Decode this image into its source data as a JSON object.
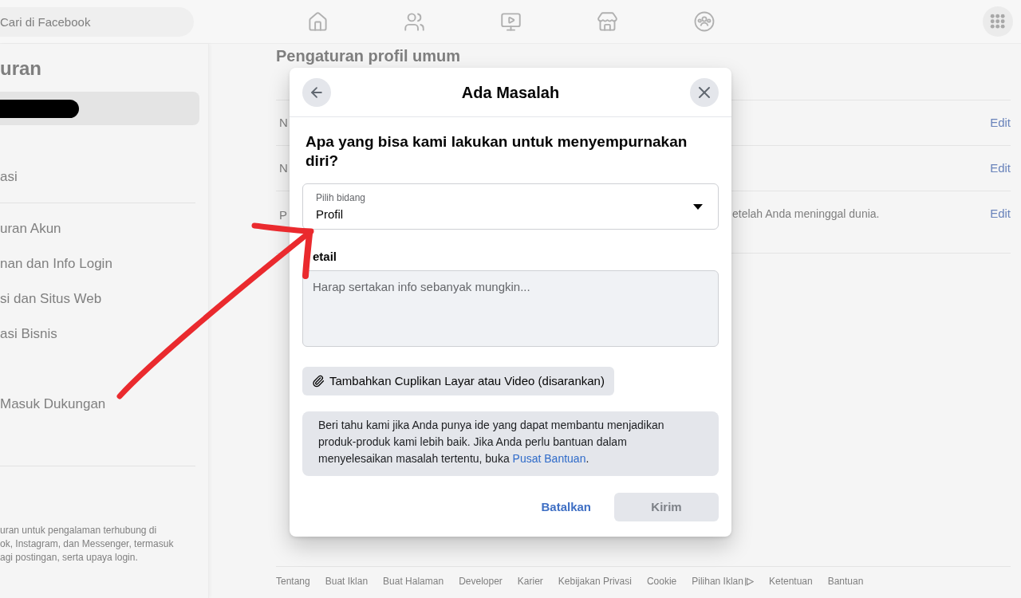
{
  "top_bar": {
    "search": {
      "placeholder": "Cari di Facebook"
    }
  },
  "sidebar": {
    "title": "uran",
    "sections": [
      {
        "items": [
          {
            "kind": "redacted",
            "selected": true
          },
          {
            "kind": "link",
            "label": "asi",
            "selected": false
          }
        ]
      },
      {
        "divider": true,
        "items": [
          {
            "kind": "link",
            "label": "uran Akun",
            "selected": false
          },
          {
            "kind": "link",
            "label": "nan dan Info Login",
            "selected": false
          },
          {
            "kind": "link",
            "label": "si dan Situs Web",
            "selected": false
          },
          {
            "kind": "link",
            "label": "asi Bisnis",
            "selected": false
          }
        ]
      },
      {
        "divider": false,
        "items": [
          {
            "kind": "link",
            "label": "Masuk Dukungan",
            "selected": false
          }
        ]
      }
    ],
    "note_lines": [
      "uran untuk pengalaman terhubung di",
      "ok, Instagram, dan Messenger, termasuk",
      "agi postingan, serta upaya login."
    ]
  },
  "main": {
    "heading": "Pengaturan profil umum",
    "rows": [
      {
        "label": "N",
        "edit": "Edit"
      },
      {
        "label": "N",
        "edit": "Edit"
      },
      {
        "label": "P",
        "description": "etelah Anda meninggal dunia.",
        "edit": "Edit"
      }
    ]
  },
  "dialog": {
    "title": "Ada Masalah",
    "question": "Apa yang bisa kami lakukan untuk menyempurnakan diri?",
    "select": {
      "label": "Pilih bidang",
      "value": "Profil"
    },
    "detail": {
      "label": "etail",
      "placeholder": "Harap sertakan info sebanyak mungkin..."
    },
    "attach_button": "Tambahkan Cuplikan Layar atau Video (disarankan)",
    "info": {
      "text": "Beri tahu kami jika Anda punya ide yang dapat membantu menjadikan produk-produk kami lebih baik. Jika Anda perlu bantuan dalam menyelesaikan masalah tertentu, buka ",
      "link": "Pusat Bantuan",
      "after": "."
    },
    "buttons": [
      {
        "kind": "cancel",
        "label": "Batalkan",
        "disabled": false
      },
      {
        "kind": "submit",
        "label": "Kirim",
        "disabled": true
      }
    ]
  },
  "footer_links": [
    {
      "kind": "link",
      "label": "Tentang"
    },
    {
      "kind": "link",
      "label": "Buat Iklan"
    },
    {
      "kind": "link",
      "label": "Buat Halaman"
    },
    {
      "kind": "link",
      "label": "Developer"
    },
    {
      "kind": "link",
      "label": "Karier"
    },
    {
      "kind": "link",
      "label": "Kebijakan Privasi"
    },
    {
      "kind": "link",
      "label": "Cookie"
    },
    {
      "kind": "ad_choices",
      "label": "Pilihan Iklan"
    },
    {
      "kind": "link",
      "label": "Ketentuan"
    },
    {
      "kind": "link",
      "label": "Bantuan"
    }
  ]
}
